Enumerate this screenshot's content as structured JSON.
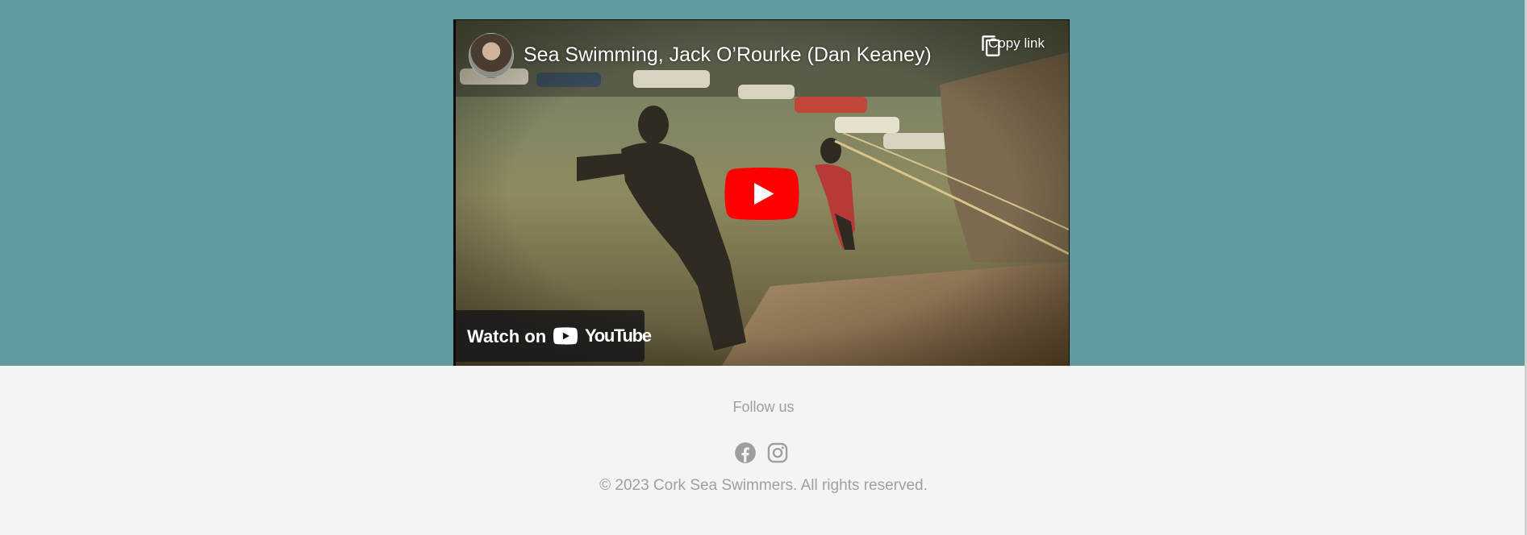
{
  "video": {
    "title": "Sea Swimming, Jack O’Rourke (Dan Keaney)",
    "copy_link_label": "Copy link",
    "watch_on_label": "Watch on",
    "youtube_wordmark": "YouTube",
    "icons": [
      "channel-avatar",
      "copy-link-icon",
      "play-icon",
      "youtube-logo"
    ],
    "play_color": "#ff0000"
  },
  "footer": {
    "follow_us": "Follow us",
    "socials": [
      {
        "name": "Facebook",
        "icon": "facebook-icon"
      },
      {
        "name": "Instagram",
        "icon": "instagram-icon"
      }
    ],
    "copyright": "© 2023 Cork Sea Swimmers. All rights reserved."
  },
  "colors": {
    "hero_background": "#5f9b9e",
    "footer_background": "#f4f4f4",
    "footer_text": "#9e9e9e"
  }
}
